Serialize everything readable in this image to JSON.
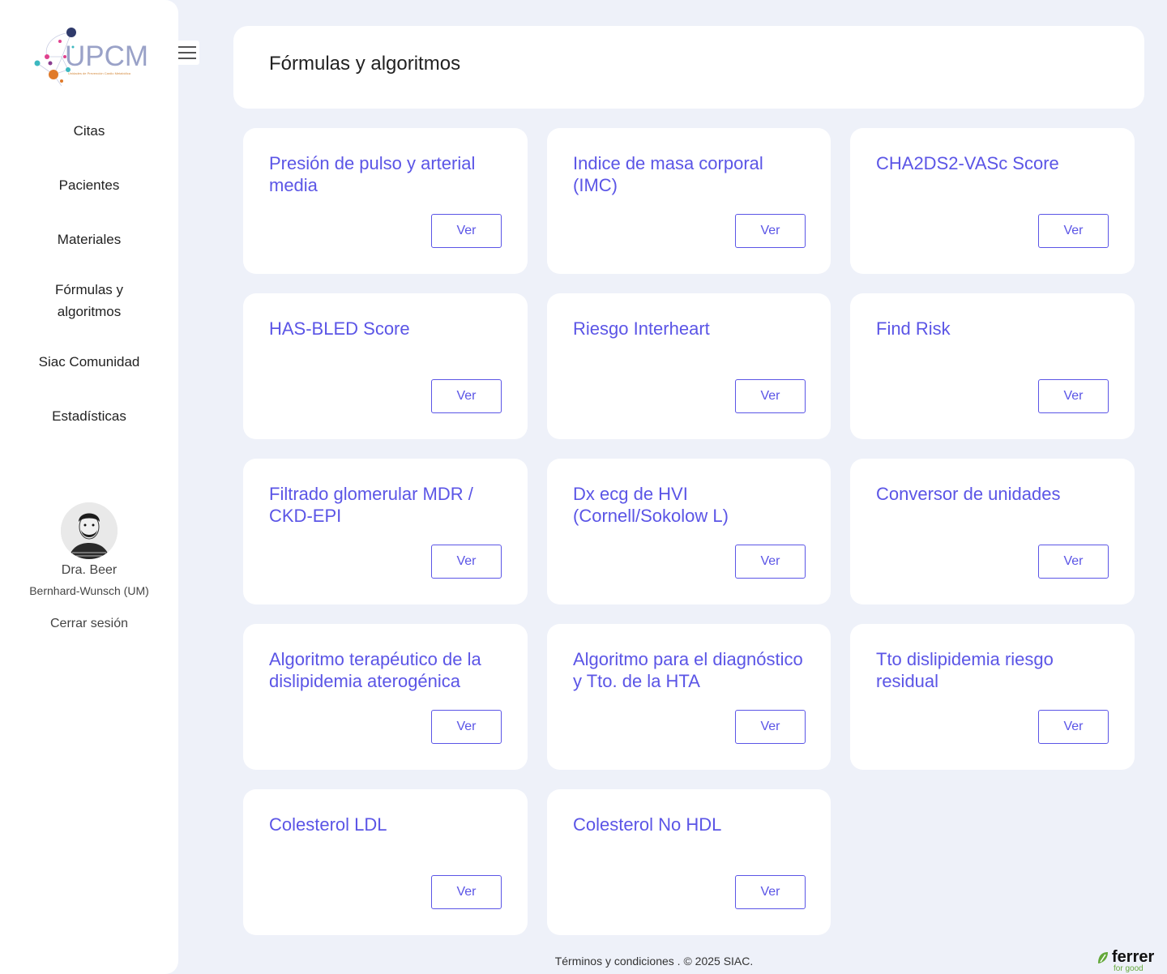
{
  "sidebar": {
    "logo_text": "UPCM",
    "logo_subtitle": "Unidades de Prevención Cardio Metabólica",
    "menu_icon": "hamburger-menu-icon",
    "nav": [
      {
        "label": "Citas"
      },
      {
        "label": "Pacientes"
      },
      {
        "label": "Materiales"
      },
      {
        "label": "Fórmulas y algoritmos"
      },
      {
        "label": "Siac Comunidad"
      },
      {
        "label": "Estadísticas"
      }
    ],
    "user": {
      "name": "Dra. Beer",
      "institution": "Bernhard-Wunsch (UM)",
      "logout": "Cerrar sesión"
    }
  },
  "header": {
    "title": "Fórmulas y algoritmos"
  },
  "cards": [
    {
      "title": "Presión de pulso y arterial media",
      "button": "Ver"
    },
    {
      "title": "Indice de masa corporal (IMC)",
      "button": "Ver"
    },
    {
      "title": "CHA2DS2-VASc Score",
      "button": "Ver"
    },
    {
      "title": "HAS-BLED Score",
      "button": "Ver"
    },
    {
      "title": "Riesgo Interheart",
      "button": "Ver"
    },
    {
      "title": "Find Risk",
      "button": "Ver"
    },
    {
      "title": "Filtrado glomerular MDR / CKD-EPI",
      "button": "Ver"
    },
    {
      "title": "Dx ecg de HVI (Cornell/Sokolow L)",
      "button": "Ver"
    },
    {
      "title": "Conversor de unidades",
      "button": "Ver"
    },
    {
      "title": "Algoritmo terapéutico de la dislipidemia aterogénica",
      "button": "Ver"
    },
    {
      "title": "Algoritmo para el diagnóstico y Tto. de la HTA",
      "button": "Ver"
    },
    {
      "title": "Tto dislipidemia riesgo residual",
      "button": "Ver"
    },
    {
      "title": "Colesterol LDL",
      "button": "Ver"
    },
    {
      "title": "Colesterol No HDL",
      "button": "Ver"
    }
  ],
  "footer": {
    "text": "Términos y condiciones . © 2025 SIAC."
  },
  "brand": {
    "name": "ferrer",
    "tagline": "for good"
  },
  "colors": {
    "accent": "#5b55e6",
    "background": "#eef1f9",
    "card": "#ffffff"
  }
}
